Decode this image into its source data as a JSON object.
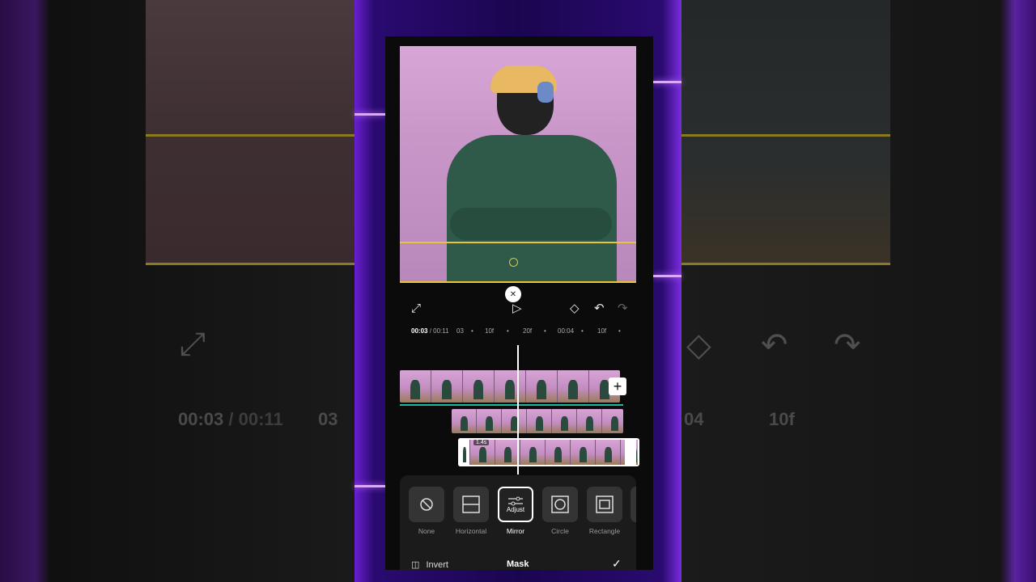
{
  "background": {
    "time_current": "00:03",
    "time_total": "/ 00:11",
    "frame_marker_left": "03",
    "frame_marker_right": "04",
    "frame_label": "10f"
  },
  "toolbar": {
    "fullscreen_icon": "expand-icon",
    "play_icon": "play-icon",
    "keyframe_icon": "keyframe-add-icon",
    "undo_icon": "undo-icon",
    "redo_icon": "redo-icon"
  },
  "ruler": {
    "current": "00:03",
    "total": "/ 00:11",
    "marks": [
      "03",
      "10f",
      "20f",
      "00:04",
      "10f"
    ]
  },
  "timeline": {
    "clip_duration": "1.4s",
    "add_label": "+"
  },
  "mask_options": [
    {
      "label": "None",
      "icon": "none-icon"
    },
    {
      "label": "Horizontal",
      "icon": "horizontal-mask-icon"
    },
    {
      "label": "Mirror",
      "icon": "mirror-mask-icon",
      "overlay": "Adjust",
      "selected": true
    },
    {
      "label": "Circle",
      "icon": "circle-mask-icon"
    },
    {
      "label": "Rectangle",
      "icon": "rectangle-mask-icon"
    }
  ],
  "footer": {
    "invert_label": "Invert",
    "title": "Mask",
    "confirm_icon": "checkmark-icon"
  },
  "colors": {
    "accent_yellow": "#e7c537",
    "timeline_green": "#1fb9a0",
    "glow_purple": "#7a2ce0"
  }
}
